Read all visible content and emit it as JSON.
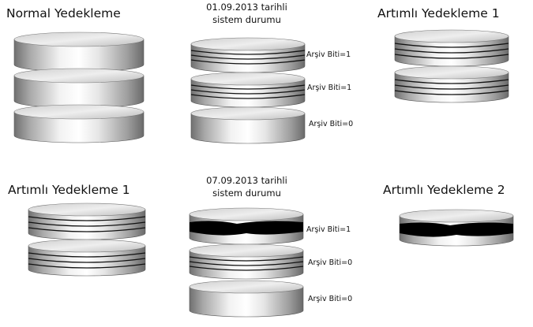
{
  "texts": {
    "normal_backup": "Normal Yedekleme",
    "state1_line1": "01.09.2013 tarihli",
    "state1_line2": "sistem durumu",
    "inc1_top": "Artımlı Yedekleme 1",
    "inc1_bottom": "Artımlı Yedekleme 1",
    "state2_line1": "07.09.2013 tarihli",
    "state2_line2": "sistem durumu",
    "inc2": "Artımlı Yedekleme 2"
  },
  "archive_bits": {
    "s1_a": "Arşiv Biti=1",
    "s1_b": "Arşiv Biti=1",
    "s1_c": "Arşiv Biti=0",
    "s2_a": "Arşiv Biti=1",
    "s2_b": "Arşiv Biti=0",
    "s2_c": "Arşiv Biti=0"
  },
  "colors": {
    "disk_light": "#f4f4f4",
    "disk_mid": "#c9c9c9",
    "disk_dark": "#6e6e6e",
    "stripe": "#111111",
    "changed_band": "#000000"
  }
}
